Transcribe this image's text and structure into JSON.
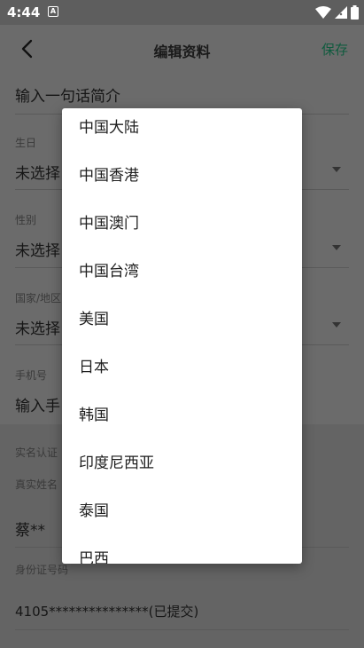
{
  "status_bar": {
    "time": "4:44",
    "notification_letter": "A"
  },
  "app_bar": {
    "title": "编辑资料",
    "save_label": "保存",
    "save_color": "#0f5b3e"
  },
  "form": {
    "bio_placeholder": "输入一句话简介",
    "birthday": {
      "label": "生日",
      "value": "未选择"
    },
    "gender": {
      "label": "性别",
      "value": "未选择"
    },
    "region": {
      "label": "国家/地区",
      "value": "未选择"
    },
    "phone": {
      "label": "手机号",
      "placeholder": "输入手"
    },
    "verify": {
      "section_label": "实名认证",
      "name_label": "真实姓名",
      "name_value": "蔡**",
      "id_label": "身份证号码",
      "id_value": "4105***************(已提交)"
    }
  },
  "dialog": {
    "options": [
      "中国大陆",
      "中国香港",
      "中国澳门",
      "中国台湾",
      "美国",
      "日本",
      "韩国",
      "印度尼西亚",
      "泰国",
      "巴西"
    ]
  }
}
